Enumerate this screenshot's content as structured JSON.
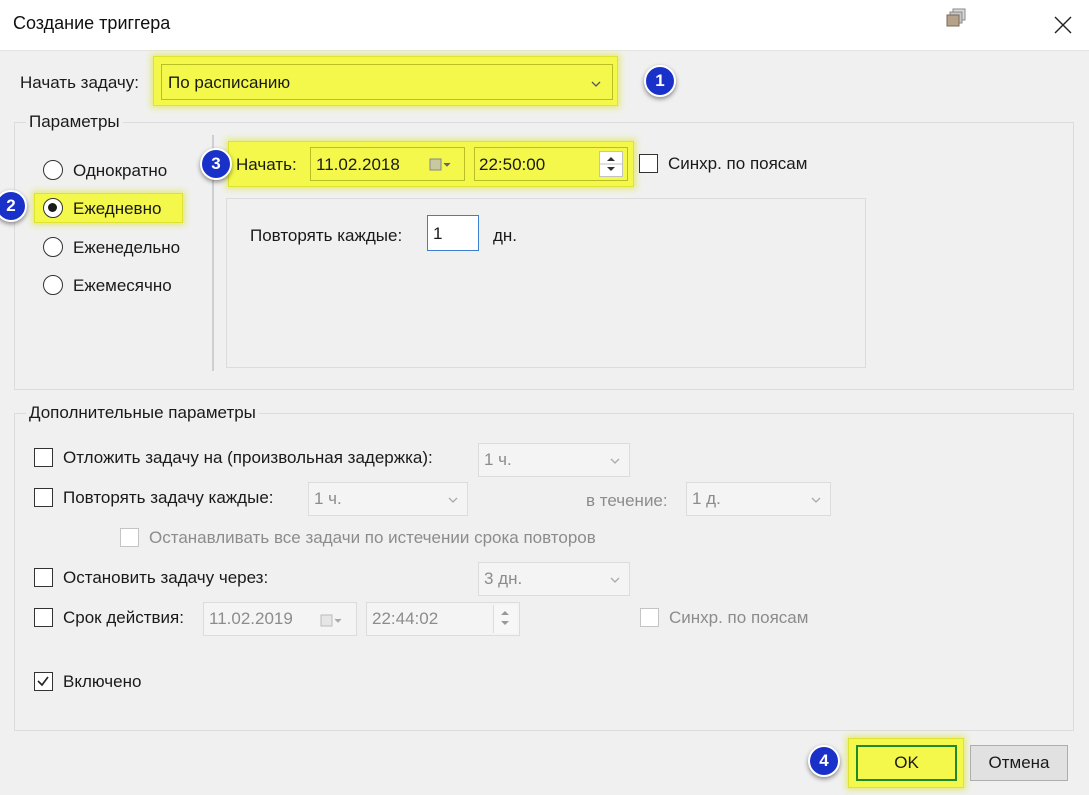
{
  "window": {
    "title": "Создание триггера",
    "close_glyph": "✕"
  },
  "start_task": {
    "label": "Начать задачу:",
    "selected": "По расписанию",
    "badge": "1"
  },
  "parameters": {
    "title": "Параметры",
    "radios": [
      {
        "label": "Однократно",
        "checked": false
      },
      {
        "label": "Ежедневно",
        "checked": true,
        "badge": "2"
      },
      {
        "label": "Еженедельно",
        "checked": false
      },
      {
        "label": "Ежемесячно",
        "checked": false
      }
    ],
    "start_label": "Начать:",
    "start_date": "11.02.2018",
    "start_time": "22:50:00",
    "start_badge": "3",
    "sync_tz_label": "Синхр. по поясам",
    "repeat_every_label": "Повторять каждые:",
    "repeat_every_value": "1",
    "repeat_unit": "дн."
  },
  "advanced": {
    "title": "Дополнительные параметры",
    "delay_label": "Отложить задачу на (произвольная задержка):",
    "delay_value": "1 ч.",
    "repeat_label": "Повторять задачу каждые:",
    "repeat_value": "1 ч.",
    "during_label": "в течение:",
    "during_value": "1 д.",
    "stop_all_label": "Останавливать все задачи по истечении срока повторов",
    "stop_after_label": "Остановить задачу через:",
    "stop_after_value": "3 дн.",
    "expire_label": "Срок действия:",
    "expire_date": "11.02.2019",
    "expire_time": "22:44:02",
    "expire_sync_label": "Синхр. по поясам",
    "enabled_label": "Включено",
    "enabled_checked": true
  },
  "buttons": {
    "ok_label": "OK",
    "ok_badge": "4",
    "cancel_label": "Отмена"
  },
  "colors": {
    "highlight": "#f3f84a",
    "badge": "#1a31c9",
    "dialog_bg": "#f0f0f0"
  }
}
